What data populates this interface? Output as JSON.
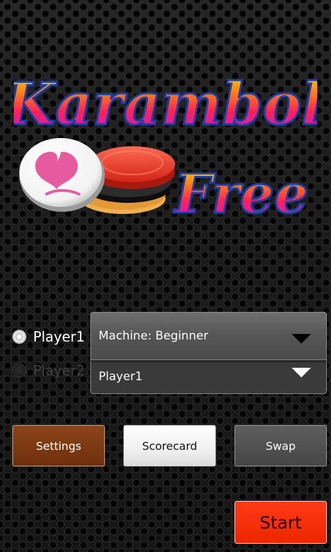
{
  "logo": {
    "line1": "Karambol",
    "line2": "Free",
    "colors": {
      "text_top": "#ffd200",
      "text_mid": "#ff2a4a",
      "text_bottom": "#a020f0",
      "outline": "#1a3fa8",
      "coin_white": "#ffffff",
      "coin_emblem": "#e85aa0",
      "coin_red": "#e03a2a",
      "coin_black": "#222222",
      "coin_tan": "#f0b050"
    }
  },
  "players": [
    {
      "label": "Player1",
      "selected": true
    },
    {
      "label": "Player2",
      "selected": false
    }
  ],
  "selects": [
    {
      "value": "Machine: Beginner"
    },
    {
      "value": "Player1"
    }
  ],
  "buttons": {
    "settings": "Settings",
    "scorecard": "Scorecard",
    "swap": "Swap",
    "start": "Start"
  },
  "colors": {
    "settings_bg": "#7a3510",
    "scorecard_bg": "#f4f4f4",
    "swap_bg": "#505050",
    "start_bg": "#ff2a00"
  }
}
